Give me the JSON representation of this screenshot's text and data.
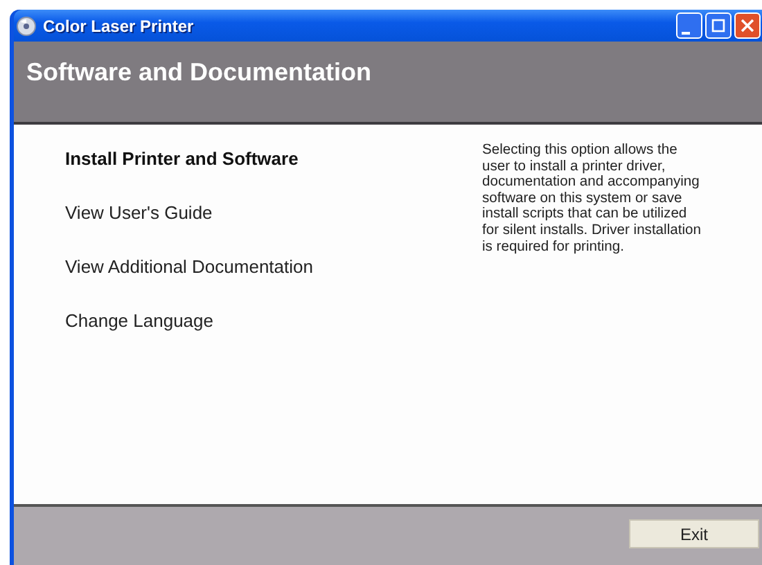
{
  "window": {
    "title": "Color Laser Printer"
  },
  "header": {
    "title": "Software and Documentation"
  },
  "menu": [
    {
      "label": "Install Printer and Software",
      "selected": true
    },
    {
      "label": "View User's Guide",
      "selected": false
    },
    {
      "label": "View Additional Documentation",
      "selected": false
    },
    {
      "label": "Change Language",
      "selected": false
    }
  ],
  "description": "Selecting this option allows the user to install a printer driver, documentation and accompanying software on this system or save install scripts that can be utilized for silent installs. Driver installation is required for printing.",
  "buttons": [
    {
      "label": "Exit"
    }
  ]
}
